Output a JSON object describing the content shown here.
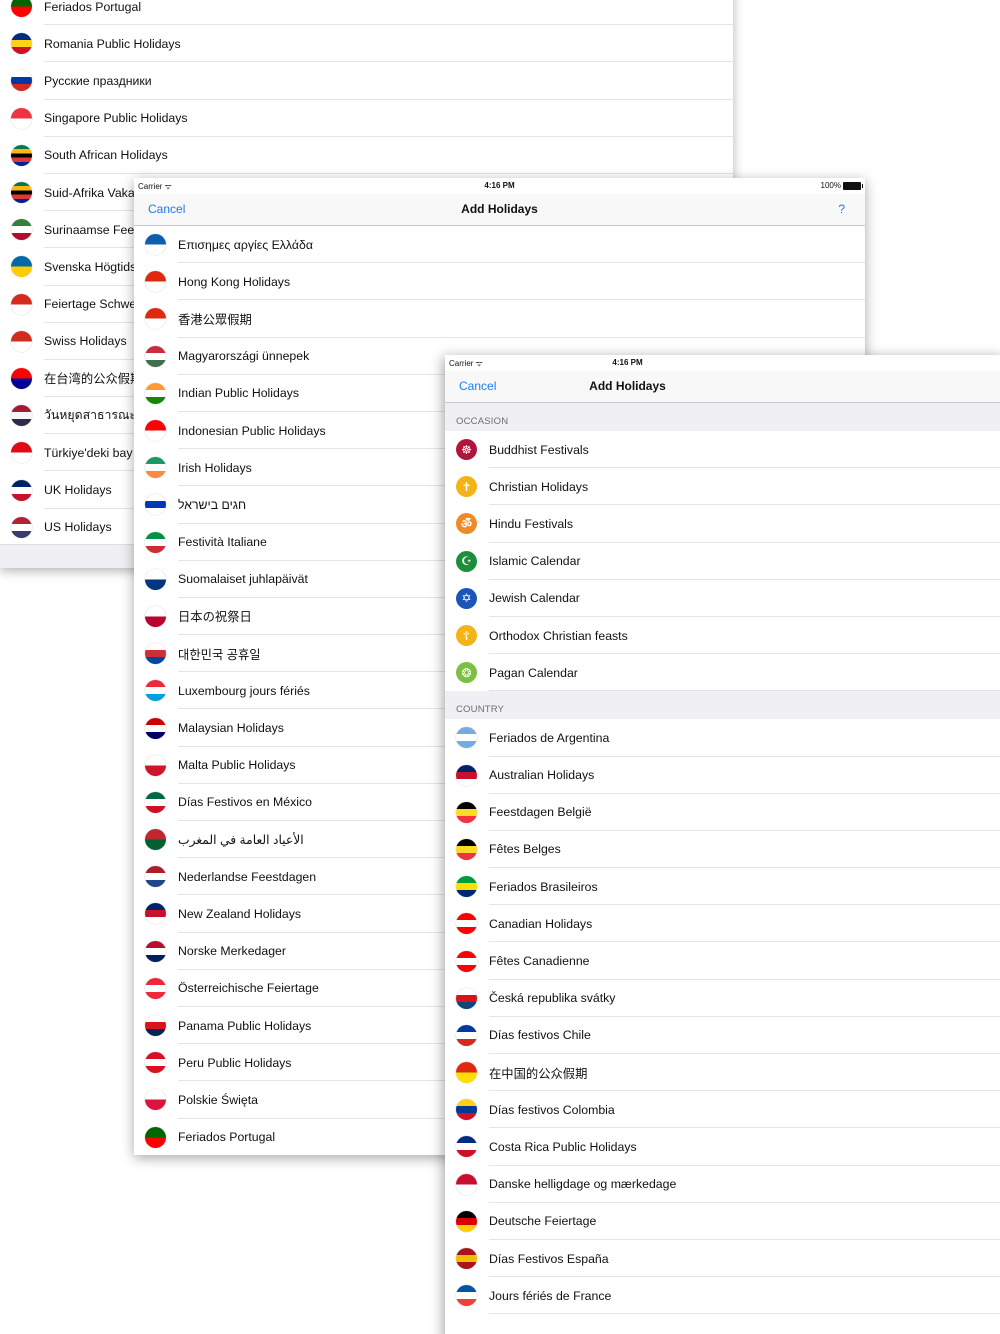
{
  "panel1": {
    "items": [
      {
        "label": "Feriados Portugal",
        "flag": [
          "#006600",
          "#ff0000"
        ]
      },
      {
        "label": "Romania Public Holidays",
        "flag": [
          "#002b7f",
          "#fcd116",
          "#ce1126"
        ]
      },
      {
        "label": "Русские праздники",
        "flag": [
          "#ffffff",
          "#0039a6",
          "#d52b1e"
        ]
      },
      {
        "label": "Singapore Public Holidays",
        "flag": [
          "#ef3340",
          "#ffffff"
        ]
      },
      {
        "label": "South African Holidays",
        "flag": [
          "#007a4d",
          "#ffb612",
          "#000000",
          "#de3831",
          "#002395"
        ]
      },
      {
        "label": "Suid-Afrika Vaka",
        "flag": [
          "#007a4d",
          "#ffb612",
          "#000000",
          "#de3831",
          "#002395"
        ]
      },
      {
        "label": "Surinaamse Fees",
        "flag": [
          "#377e3f",
          "#ffffff",
          "#b40a2d"
        ]
      },
      {
        "label": "Svenska Högtids",
        "flag": [
          "#006aa7",
          "#fecc00"
        ]
      },
      {
        "label": "Feiertage Schwe",
        "flag": [
          "#d52b1e",
          "#ffffff"
        ]
      },
      {
        "label": "Swiss Holidays",
        "flag": [
          "#d52b1e",
          "#ffffff"
        ]
      },
      {
        "label": "在台湾的公众假期",
        "flag": [
          "#fe0000",
          "#000095"
        ]
      },
      {
        "label": "วันหยุดสาธารณะแ",
        "flag": [
          "#a51931",
          "#f4f5f8",
          "#2d2a4a"
        ]
      },
      {
        "label": "Türkiye'deki bay",
        "flag": [
          "#e30a17",
          "#ffffff"
        ]
      },
      {
        "label": "UK Holidays",
        "flag": [
          "#012169",
          "#ffffff",
          "#c8102e"
        ]
      },
      {
        "label": "US Holidays",
        "flag": [
          "#b22234",
          "#ffffff",
          "#3c3b6e"
        ]
      }
    ]
  },
  "panel2": {
    "status": {
      "carrier": "Carrier",
      "time": "4:16 PM",
      "battery": "100%"
    },
    "nav": {
      "cancel": "Cancel",
      "title": "Add Holidays",
      "help": "?"
    },
    "items": [
      {
        "label": "Επισημες αργίες Ελλάδα",
        "flag": [
          "#0d5eaf",
          "#ffffff"
        ]
      },
      {
        "label": "Hong Kong Holidays",
        "flag": [
          "#de2910",
          "#ffffff"
        ]
      },
      {
        "label": "香港公眾假期",
        "flag": [
          "#de2910",
          "#ffffff"
        ]
      },
      {
        "label": "Magyarországi ünnepek",
        "flag": [
          "#cd2a3e",
          "#ffffff",
          "#436f4d"
        ]
      },
      {
        "label": "Indian Public Holidays",
        "flag": [
          "#ff9933",
          "#ffffff",
          "#138808"
        ]
      },
      {
        "label": "Indonesian Public Holidays",
        "flag": [
          "#ff0000",
          "#ffffff"
        ]
      },
      {
        "label": "Irish Holidays",
        "flag": [
          "#169b62",
          "#ffffff",
          "#ff883e"
        ]
      },
      {
        "label": "חגים בישראל",
        "flag": [
          "#ffffff",
          "#0038b8",
          "#ffffff"
        ]
      },
      {
        "label": "Festività Italiane",
        "flag": [
          "#009246",
          "#ffffff",
          "#ce2b37"
        ]
      },
      {
        "label": "Suomalaiset juhlapäivät",
        "flag": [
          "#ffffff",
          "#003580"
        ]
      },
      {
        "label": "日本の祝祭日",
        "flag": [
          "#ffffff",
          "#bc002d"
        ]
      },
      {
        "label": "대한민국 공휴일",
        "flag": [
          "#ffffff",
          "#cd2e3a",
          "#0047a0"
        ]
      },
      {
        "label": "Luxembourg jours fériés",
        "flag": [
          "#ed2939",
          "#ffffff",
          "#00a1de"
        ]
      },
      {
        "label": "Malaysian Holidays",
        "flag": [
          "#cc0001",
          "#ffffff",
          "#010066"
        ]
      },
      {
        "label": "Malta Public Holidays",
        "flag": [
          "#ffffff",
          "#cf142b"
        ]
      },
      {
        "label": "Días Festivos en México",
        "flag": [
          "#006847",
          "#ffffff",
          "#ce1126"
        ]
      },
      {
        "label": "الأعياد العامة في المغرب",
        "flag": [
          "#c1272d",
          "#006233"
        ]
      },
      {
        "label": "Nederlandse Feestdagen",
        "flag": [
          "#ae1c28",
          "#ffffff",
          "#21468b"
        ]
      },
      {
        "label": "New Zealand Holidays",
        "flag": [
          "#012169",
          "#c8102e",
          "#ffffff"
        ]
      },
      {
        "label": "Norske Merkedager",
        "flag": [
          "#ba0c2f",
          "#ffffff",
          "#00205b"
        ]
      },
      {
        "label": "Österreichische Feiertage",
        "flag": [
          "#ed2939",
          "#ffffff",
          "#ed2939"
        ]
      },
      {
        "label": "Panama Public Holidays",
        "flag": [
          "#ffffff",
          "#da121a",
          "#072357"
        ]
      },
      {
        "label": "Peru Public Holidays",
        "flag": [
          "#d91023",
          "#ffffff",
          "#d91023"
        ]
      },
      {
        "label": "Polskie Święta",
        "flag": [
          "#ffffff",
          "#dc143c"
        ]
      },
      {
        "label": "Feriados Portugal",
        "flag": [
          "#006600",
          "#ff0000"
        ]
      }
    ]
  },
  "panel3": {
    "status": {
      "carrier": "Carrier",
      "time": "4:16 PM"
    },
    "nav": {
      "cancel": "Cancel",
      "title": "Add Holidays"
    },
    "occasion_header": "OCCASION",
    "occasion": [
      {
        "label": "Buddhist Festivals",
        "icon": "dharma-wheel-icon",
        "glyph": "☸",
        "color": "#b0163c"
      },
      {
        "label": "Christian Holidays",
        "icon": "cross-icon",
        "glyph": "✝",
        "color": "#f5b31a"
      },
      {
        "label": "Hindu Festivals",
        "icon": "om-icon",
        "glyph": "ॐ",
        "color": "#f08a24"
      },
      {
        "label": "Islamic Calendar",
        "icon": "crescent-icon",
        "glyph": "☪",
        "color": "#1d8f3a"
      },
      {
        "label": "Jewish Calendar",
        "icon": "star-of-david-icon",
        "glyph": "✡",
        "color": "#1c55b5"
      },
      {
        "label": "Orthodox Christian feasts",
        "icon": "orthodox-cross-icon",
        "glyph": "☦",
        "color": "#f5b31a"
      },
      {
        "label": "Pagan Calendar",
        "icon": "pagan-wheel-icon",
        "glyph": "❂",
        "color": "#7bc043"
      }
    ],
    "country_header": "COUNTRY",
    "country": [
      {
        "label": "Feriados de Argentina",
        "flag": [
          "#74acdf",
          "#ffffff",
          "#74acdf"
        ]
      },
      {
        "label": "Australian Holidays",
        "flag": [
          "#012169",
          "#c8102e",
          "#ffffff"
        ]
      },
      {
        "label": "Feestdagen België",
        "flag": [
          "#000000",
          "#fdda24",
          "#ef3340"
        ]
      },
      {
        "label": "Fêtes Belges",
        "flag": [
          "#000000",
          "#fdda24",
          "#ef3340"
        ]
      },
      {
        "label": "Feriados Brasileiros",
        "flag": [
          "#009c3b",
          "#ffdf00",
          "#002776"
        ]
      },
      {
        "label": "Canadian Holidays",
        "flag": [
          "#ff0000",
          "#ffffff",
          "#ff0000"
        ]
      },
      {
        "label": "Fêtes Canadienne",
        "flag": [
          "#ff0000",
          "#ffffff",
          "#ff0000"
        ]
      },
      {
        "label": "Česká republika svátky",
        "flag": [
          "#ffffff",
          "#d7141a",
          "#11457e"
        ]
      },
      {
        "label": "Días festivos Chile",
        "flag": [
          "#0039a6",
          "#ffffff",
          "#d52b1e"
        ]
      },
      {
        "label": "在中国的公众假期",
        "flag": [
          "#de2910",
          "#ffde00"
        ]
      },
      {
        "label": "Días festivos Colombia",
        "flag": [
          "#fcd116",
          "#003893",
          "#ce1126"
        ]
      },
      {
        "label": "Costa Rica Public Holidays",
        "flag": [
          "#002b7f",
          "#ffffff",
          "#ce1126"
        ]
      },
      {
        "label": "Danske helligdage og mærkedage",
        "flag": [
          "#c8102e",
          "#ffffff"
        ]
      },
      {
        "label": "Deutsche Feiertage",
        "flag": [
          "#000000",
          "#dd0000",
          "#ffce00"
        ]
      },
      {
        "label": "Días Festivos España",
        "flag": [
          "#aa151b",
          "#f1bf00",
          "#aa151b"
        ]
      },
      {
        "label": "Jours fériés de France",
        "flag": [
          "#0055a4",
          "#ffffff",
          "#ef4135"
        ]
      }
    ]
  }
}
